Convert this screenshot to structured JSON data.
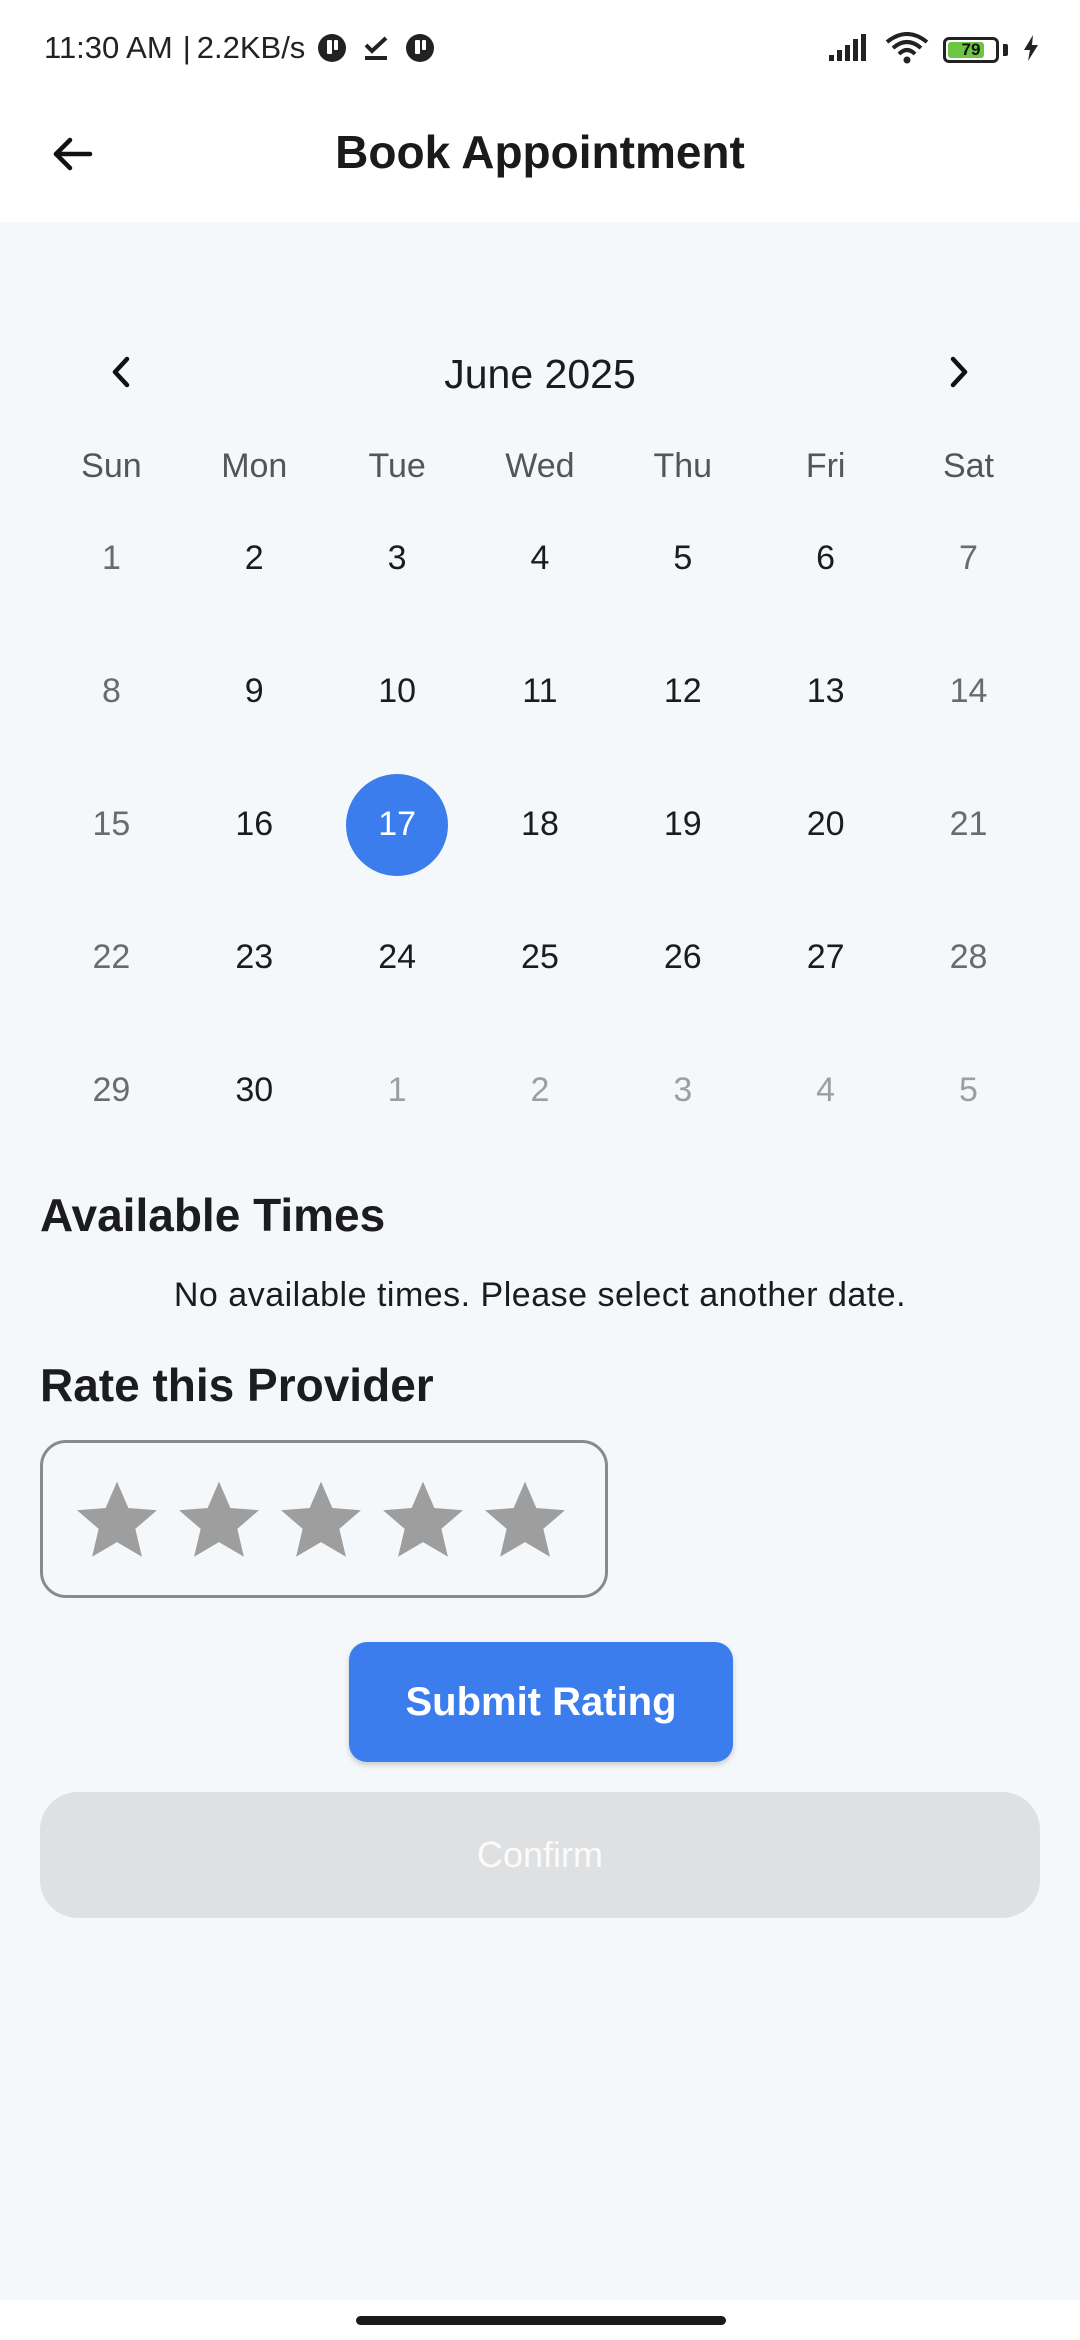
{
  "status_bar": {
    "time": "11:30 AM",
    "separator": "|",
    "net_speed": "2.2KB/s",
    "battery_level": "79",
    "battery_fraction": 0.79,
    "icons": [
      "notification-app-icon",
      "download-done-icon",
      "notification-app-icon",
      "signal-icon",
      "wifi-icon",
      "battery-icon",
      "charging-icon"
    ]
  },
  "app_bar": {
    "title": "Book Appointment",
    "back_icon": "arrow-left-icon"
  },
  "calendar": {
    "month_label": "June 2025",
    "prev_icon": "chevron-left-icon",
    "next_icon": "chevron-right-icon",
    "weekdays": [
      "Sun",
      "Mon",
      "Tue",
      "Wed",
      "Thu",
      "Fri",
      "Sat"
    ],
    "days": [
      "1",
      "2",
      "3",
      "4",
      "5",
      "6",
      "7",
      "8",
      "9",
      "10",
      "11",
      "12",
      "13",
      "14",
      "15",
      "16",
      "17",
      "18",
      "19",
      "20",
      "21",
      "22",
      "23",
      "24",
      "25",
      "26",
      "27",
      "28",
      "29",
      "30",
      "1",
      "2",
      "3",
      "4",
      "5"
    ],
    "selected_day": "17",
    "selected_color": "#3b7ded"
  },
  "available_times": {
    "title": "Available Times",
    "empty_message": "No available times. Please select another date."
  },
  "rating": {
    "title": "Rate this Provider",
    "stars_total": 5,
    "stars_selected": 0,
    "star_color": "#9e9e9e",
    "star_icon": "star-icon"
  },
  "actions": {
    "submit_label": "Submit Rating",
    "confirm_label": "Confirm",
    "accent_color": "#3b7ded"
  }
}
